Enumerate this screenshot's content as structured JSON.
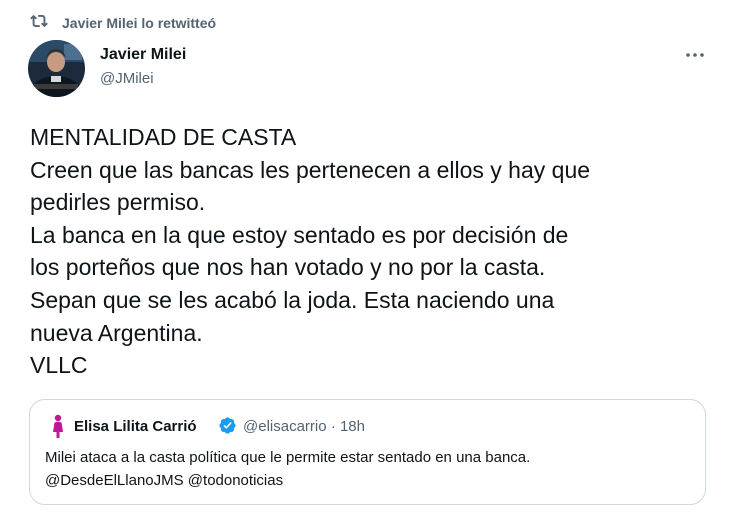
{
  "retweet": {
    "text": "Javier Milei lo retwitteó"
  },
  "author": {
    "name": "Javier Milei",
    "handle": "@JMilei"
  },
  "tweet": {
    "lines": [
      "MENTALIDAD DE CASTA",
      "Creen que las bancas les pertenecen a ellos y hay que",
      "pedirles permiso.",
      "La banca en la que estoy sentado es por decisión de",
      "los porteños que nos han votado y no por la casta.",
      "Sepan que se les acabó la joda. Esta naciendo una",
      "nueva Argentina.",
      "VLLC"
    ]
  },
  "quoted": {
    "name": "Elisa Lilita Carrió",
    "handle": "@elisacarrio",
    "separator": "·",
    "time": "18h",
    "lines": [
      "Milei ataca a la casta política que le permite estar sentado en una banca.",
      "@DesdeElLlanoJMS @todonoticias"
    ]
  },
  "colors": {
    "text": "#0f1419",
    "secondary": "#536471",
    "border": "#cfd9de",
    "verified": "#1d9bf0",
    "quoted_avatar_accent": "#c0169b"
  },
  "icons": {
    "retweet": "retweet-icon",
    "more": "more-icon",
    "verified": "verified-badge-icon"
  }
}
